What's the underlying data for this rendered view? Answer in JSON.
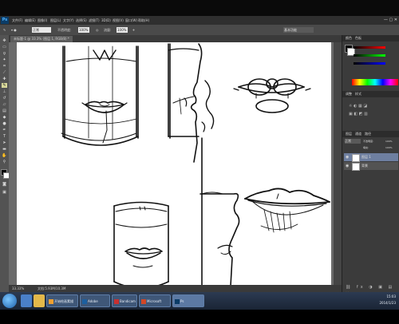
{
  "menubar": {
    "logo": "Ps",
    "items": [
      "文件(F)",
      "编辑(E)",
      "图像(I)",
      "图层(L)",
      "文字(Y)",
      "选择(S)",
      "滤镜(T)",
      "3D(D)",
      "视图(V)",
      "窗口(W)",
      "帮助(H)"
    ],
    "window_controls": "— ▢ ✕"
  },
  "options": {
    "opacity_label": "不透明度:",
    "opacity_value": "100%",
    "flow_label": "流量:",
    "flow_value": "100%",
    "mode_value": "正常",
    "right_label": "基本功能"
  },
  "document": {
    "tab_label": "未标题-1 @ 33.3% (图层 1, RGB/8) *",
    "status_zoom": "33.33%",
    "status_info": "文档:5.93M/10.3M"
  },
  "panels": {
    "color_tabs": [
      "颜色",
      "色板"
    ],
    "adjust_tabs": [
      "调整",
      "样式"
    ],
    "layers_tabs": [
      "图层",
      "通道",
      "路径"
    ],
    "blend_mode": "正常",
    "opacity_label": "不透明度:",
    "opacity_value": "100%",
    "fill_label": "填充:",
    "fill_value": "100%",
    "layers": [
      {
        "name": "图层 1",
        "selected": true
      },
      {
        "name": "背景",
        "selected": false
      }
    ]
  },
  "taskbar": {
    "buttons": [
      "开始绘画素描",
      "Adobe Photosh...",
      "Bandicam",
      "Microsoft Powe...",
      "Ps"
    ],
    "time": "15:03",
    "date": "2014/1/23"
  },
  "colors": {
    "photoshop_blue": "#4fb3ff",
    "selected_layer": "#6e7fa0",
    "canvas": "#ffffff"
  }
}
